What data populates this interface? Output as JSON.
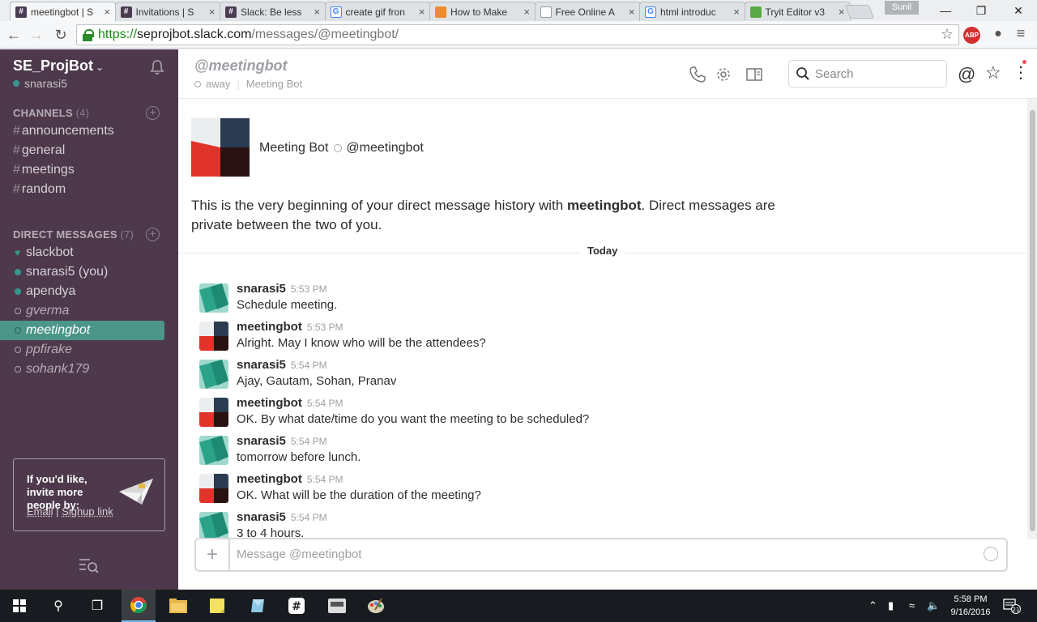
{
  "browser": {
    "tabs": [
      {
        "title": "meetingbot | S",
        "active": true
      },
      {
        "title": "Invitations | S",
        "active": false
      },
      {
        "title": "Slack: Be less",
        "active": false
      },
      {
        "title": "create gif fron",
        "active": false
      },
      {
        "title": "How to Make",
        "active": false
      },
      {
        "title": "Free Online A",
        "active": false
      },
      {
        "title": "html introduc",
        "active": false
      },
      {
        "title": "Tryit Editor v3",
        "active": false
      }
    ],
    "user_badge": "Sunil",
    "url_scheme": "https://",
    "url_host": "seprojbot.slack.com",
    "url_path": "/messages/@meetingbot/",
    "abp_label": "ABP"
  },
  "sidebar": {
    "team_name": "SE_ProjBot",
    "current_user": "snarasi5",
    "channels_header": "CHANNELS",
    "channels_count": "(4)",
    "channels": [
      "announcements",
      "general",
      "meetings",
      "random"
    ],
    "dms_header": "DIRECT MESSAGES",
    "dms_count": "(7)",
    "dms": [
      {
        "name": "slackbot",
        "status": "bot"
      },
      {
        "name": "snarasi5 (you)",
        "status": "active"
      },
      {
        "name": "apendya",
        "status": "active"
      },
      {
        "name": "gverma",
        "status": "away"
      },
      {
        "name": "meetingbot",
        "status": "away",
        "selected": true
      },
      {
        "name": "ppfirake",
        "status": "away"
      },
      {
        "name": "sohank179",
        "status": "away"
      }
    ],
    "invite_text": "If you'd like, invite more people by:",
    "invite_email": "Email",
    "invite_sep": "|",
    "invite_signup": "Signup link"
  },
  "header": {
    "title": "@meetingbot",
    "presence": "away",
    "full_name": "Meeting Bot",
    "search_placeholder": "Search"
  },
  "intro": {
    "name": "Meeting Bot",
    "handle": "@meetingbot",
    "text_before": "This is the very beginning of your direct message history with ",
    "text_bold": "meetingbot",
    "text_after": ". Direct messages are private between the two of you.",
    "day_divider": "Today"
  },
  "messages": [
    {
      "author": "snarasi5",
      "time": "5:53 PM",
      "text": "Schedule meeting.",
      "avatar": "user"
    },
    {
      "author": "meetingbot",
      "time": "5:53 PM",
      "text": "Alright. May I know  who will be the attendees?",
      "avatar": "bot"
    },
    {
      "author": "snarasi5",
      "time": "5:54 PM",
      "text": "Ajay, Gautam, Sohan, Pranav",
      "avatar": "user"
    },
    {
      "author": "meetingbot",
      "time": "5:54 PM",
      "text": "OK. By what date/time do you want the meeting to be scheduled?",
      "avatar": "bot"
    },
    {
      "author": "snarasi5",
      "time": "5:54 PM",
      "text": "tomorrow before lunch.",
      "avatar": "user"
    },
    {
      "author": "meetingbot",
      "time": "5:54 PM",
      "text": "OK. What will be the duration of the meeting?",
      "avatar": "bot"
    },
    {
      "author": "snarasi5",
      "time": "5:54 PM",
      "text": "3 to 4 hours.",
      "avatar": "user"
    }
  ],
  "composer": {
    "placeholder": "Message @meetingbot"
  },
  "taskbar": {
    "time": "5:58 PM",
    "date": "9/16/2016",
    "notifications": "21"
  },
  "colors": {
    "sidebar_bg": "#4d394b",
    "active_item": "#4c9689",
    "presence_green": "#38978d",
    "bot_red": "#e0332a",
    "bot_navy": "#2b3c51"
  }
}
